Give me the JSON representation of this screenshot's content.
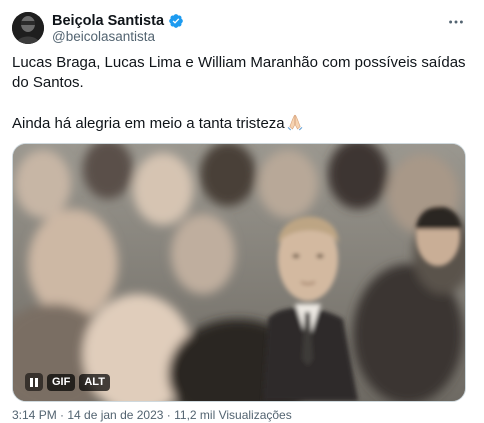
{
  "author": {
    "display_name": "Beiçola Santista",
    "handle": "@beicolasantista"
  },
  "tweet": {
    "paragraph_1": "Lucas Braga, Lucas Lima e William Maranhão com possíveis saídas do Santos.",
    "paragraph_2": "Ainda há alegria em meio a tanta tristeza"
  },
  "media": {
    "gif_label": "GIF",
    "alt_label": "ALT"
  },
  "icons": {
    "verified": "verified-badge-icon",
    "more": "more-dots-icon",
    "emoji": "praying-hands-emoji",
    "pause": "pause-icon"
  },
  "colors": {
    "verified_blue": "#1d9bf0",
    "text": "#0f1419",
    "secondary_text": "#536471"
  },
  "footer": {
    "timestamp_partial": "3:14 PM · 14 de jan de 2023 · 11,2 mil Visualizações"
  }
}
